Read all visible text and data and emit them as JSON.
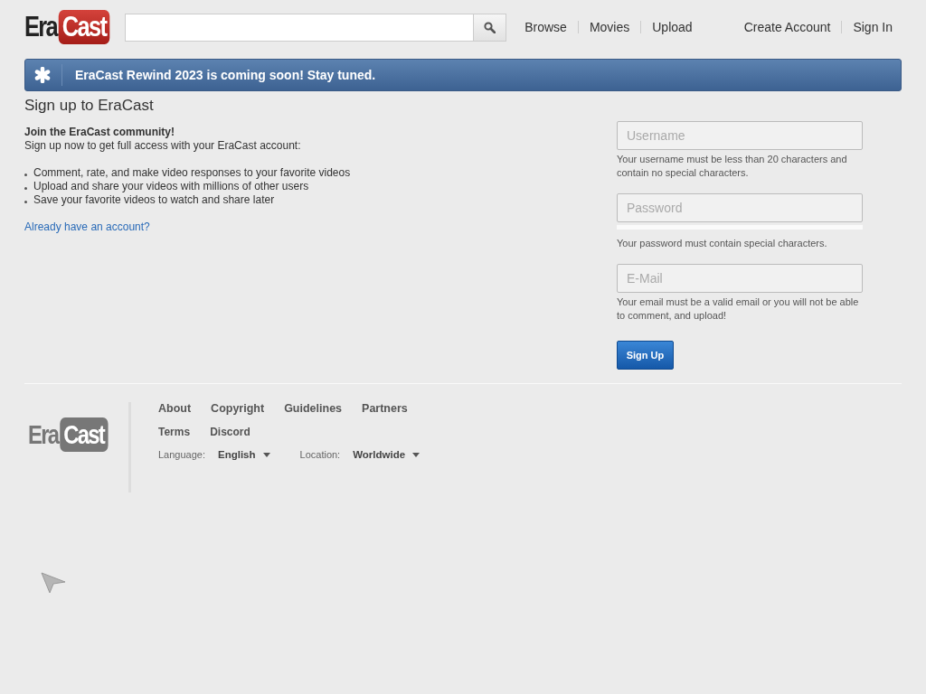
{
  "header": {
    "logo": {
      "first": "Era",
      "second": "Cast"
    },
    "nav": [
      "Browse",
      "Movies",
      "Upload"
    ],
    "account_links": [
      "Create Account",
      "Sign In"
    ]
  },
  "notice": {
    "text": "EraCast Rewind 2023 is coming soon! Stay tuned."
  },
  "signup": {
    "title": "Sign up to EraCast",
    "intro_title": "Join the EraCast community!",
    "intro": "Sign up now to get full access with your EraCast account:",
    "benefits": [
      "Comment, rate, and make video responses to your favorite videos",
      "Upload and share your videos with millions of other users",
      "Save your favorite videos to watch and share later"
    ],
    "login_link": "Already have an account?",
    "fields": [
      {
        "placeholder": "Username",
        "hint": "Your username must be less than 20 characters and contain no special characters.",
        "kind": "text"
      },
      {
        "placeholder": "Password",
        "hint": "Your password must contain special characters.",
        "kind": "password"
      },
      {
        "placeholder": "E-Mail",
        "hint": "Your email must be a valid email or you will not be able to comment, and upload!",
        "kind": "text"
      }
    ],
    "button": "Sign Up"
  },
  "footer": {
    "logo": {
      "first": "Era",
      "second": "Cast"
    },
    "links": [
      [
        "About",
        "Copyright",
        "Guidelines",
        "Partners"
      ],
      [
        "Terms",
        "Discord"
      ]
    ],
    "settings": [
      {
        "label": "Language:",
        "value": "English"
      },
      {
        "label": "Location:",
        "value": "Worldwide"
      }
    ]
  }
}
